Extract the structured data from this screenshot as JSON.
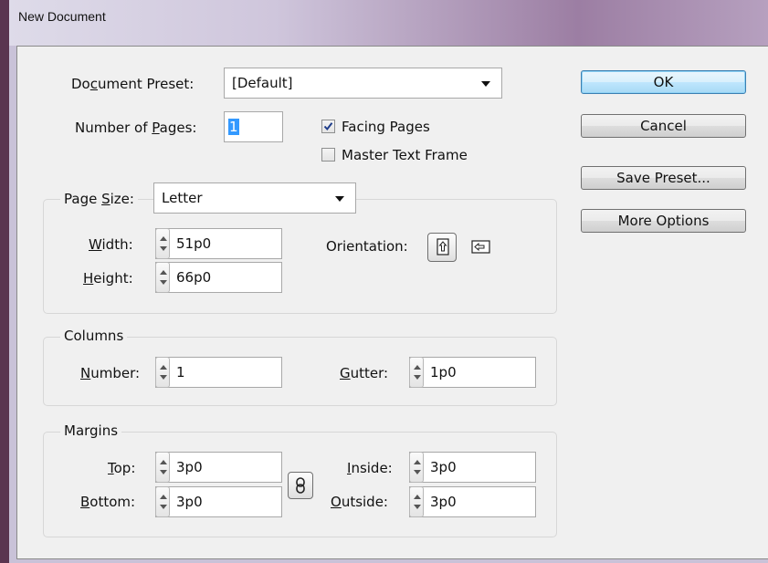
{
  "window": {
    "title": "New Document"
  },
  "preset": {
    "label_pre": "Do",
    "label_u": "c",
    "label_post": "ument Preset:",
    "value": "[Default]"
  },
  "pages": {
    "label_pre": "Number of ",
    "label_u": "P",
    "label_post": "ages:",
    "value": "1"
  },
  "facing_pages": {
    "label": "Facing Pages",
    "checked": true
  },
  "master_text_frame": {
    "label": "Master Text Frame",
    "checked": false
  },
  "page_size": {
    "label_pre": "Page ",
    "label_u": "S",
    "label_post": "ize:",
    "value": "Letter",
    "width": {
      "label_u": "W",
      "label_post": "idth:",
      "value": "51p0"
    },
    "height": {
      "label_u": "H",
      "label_post": "eight:",
      "value": "66p0"
    },
    "orientation_label": "Orientation:",
    "portrait_icon": "portrait-page-icon",
    "landscape_icon": "landscape-page-icon"
  },
  "columns": {
    "legend": "Columns",
    "number": {
      "label_u": "N",
      "label_post": "umber:",
      "value": "1"
    },
    "gutter": {
      "label_u": "G",
      "label_post": "utter:",
      "value": "1p0"
    }
  },
  "margins": {
    "legend": "Margins",
    "top": {
      "label_u": "T",
      "label_post": "op:",
      "value": "3p0"
    },
    "bottom": {
      "label_u": "B",
      "label_post": "ottom:",
      "value": "3p0"
    },
    "inside": {
      "label_u": "I",
      "label_post": "nside:",
      "value": "3p0"
    },
    "outside": {
      "label_u": "O",
      "label_post": "utside:",
      "value": "3p0"
    },
    "link_icon": "chain-link-icon"
  },
  "buttons": {
    "ok": "OK",
    "cancel": "Cancel",
    "save_preset": "Save Preset...",
    "more_options": "More Options"
  }
}
